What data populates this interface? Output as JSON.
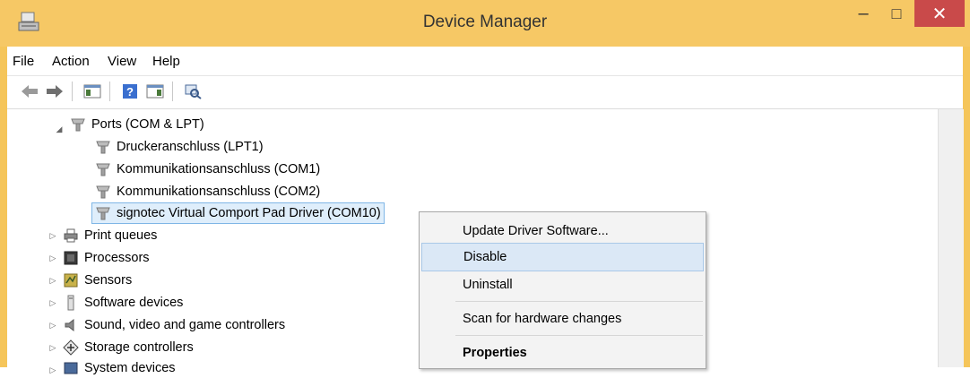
{
  "window": {
    "title": "Device Manager",
    "min_glyph": "–",
    "max_glyph": "□",
    "close_glyph": "✕"
  },
  "menu": [
    "File",
    "Action",
    "View",
    "Help"
  ],
  "tree": {
    "ports": "Ports (COM & LPT)",
    "port_children": [
      "Druckeranschluss (LPT1)",
      "Kommunikationsanschluss (COM1)",
      "Kommunikationsanschluss (COM2)",
      "signotec Virtual Comport Pad Driver (COM10)"
    ],
    "categories": [
      "Print queues",
      "Processors",
      "Sensors",
      "Software devices",
      "Sound, video and game controllers",
      "Storage controllers",
      "System devices"
    ]
  },
  "context_menu": {
    "items": [
      "Update Driver Software...",
      "Disable",
      "Uninstall",
      "Scan for hardware changes",
      "Properties"
    ]
  },
  "colors": {
    "titlebar": "#f6c865",
    "close": "#c94a4a",
    "highlight": "#dbe8f6"
  }
}
